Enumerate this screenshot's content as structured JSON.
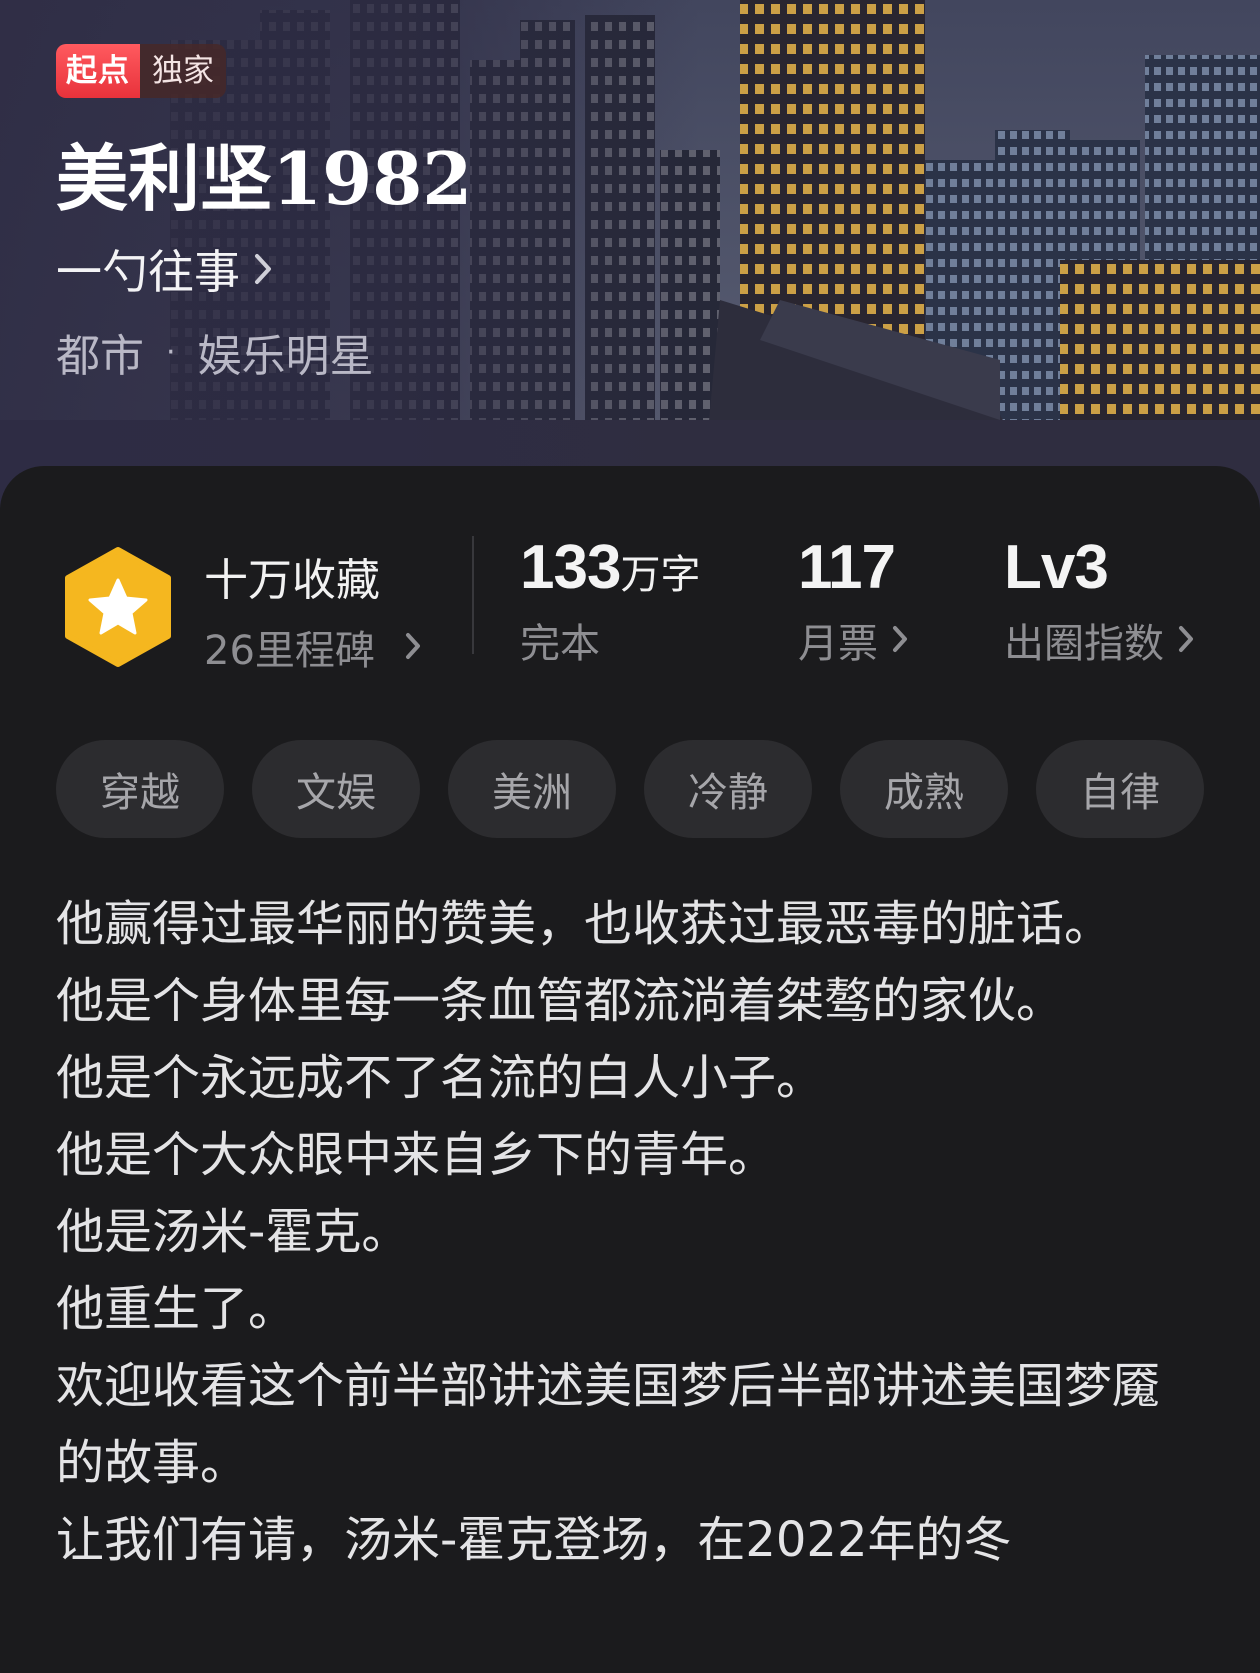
{
  "hero": {
    "badge_brand": "起点",
    "badge_exclusive": "独家",
    "title": "美利坚1982",
    "author": "一勺往事",
    "genre_main": "都市",
    "genre_dot": "·",
    "genre_sub": "娱乐明星"
  },
  "stats": {
    "collect_title": "十万收藏",
    "collect_sub": "26里程碑",
    "words_num": "133",
    "words_unit": "万字",
    "words_sub": "完本",
    "tickets_num": "117",
    "tickets_sub": "月票",
    "level_num": "Lv3",
    "level_sub": "出圈指数"
  },
  "tags": [
    "穿越",
    "文娱",
    "美洲",
    "冷静",
    "成熟",
    "自律"
  ],
  "description": [
    "他赢得过最华丽的赞美，也收获过最恶毒的脏话。",
    "他是个身体里每一条血管都流淌着桀骜的家伙。",
    "他是个永远成不了名流的白人小子。",
    "他是个大众眼中来自乡下的青年。",
    "他是汤米-霍克。",
    "他重生了。",
    "欢迎收看这个前半部讲述美国梦后半部讲述美国梦魇的故事。",
    "让我们有请，汤米-霍克登场，在2022年的冬"
  ],
  "icons": {
    "badge": "star-hexagon-icon",
    "chevron": "chevron-right-icon"
  },
  "colors": {
    "brand_red": "#e8323b",
    "hex_yellow": "#f5b71f",
    "background": "#1b1b1d",
    "tag_bg": "#2c2c2f"
  }
}
